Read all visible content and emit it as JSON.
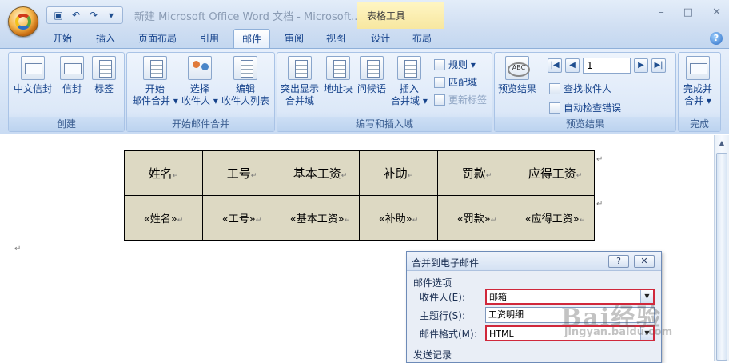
{
  "window": {
    "title": "新建 Microsoft Office Word 文档 - Microsoft...",
    "context_group": "表格工具",
    "minimize": "–",
    "restore": "□",
    "close": "✕"
  },
  "quick_access": {
    "save": "save-icon",
    "undo": "↶",
    "redo": "↷",
    "more": "▾"
  },
  "tabs": [
    {
      "label": "开始"
    },
    {
      "label": "插入"
    },
    {
      "label": "页面布局"
    },
    {
      "label": "引用"
    },
    {
      "label": "邮件"
    },
    {
      "label": "审阅"
    },
    {
      "label": "视图"
    },
    {
      "label": "设计"
    },
    {
      "label": "布局"
    }
  ],
  "active_tab": "邮件",
  "ribbon": {
    "create": {
      "label": "创建",
      "buttons": [
        "中文信封",
        "信封",
        "标签"
      ]
    },
    "start_merge": {
      "label": "开始邮件合并",
      "buttons": [
        {
          "line1": "开始",
          "line2": "邮件合并 ▾"
        },
        {
          "line1": "选择",
          "line2": "收件人 ▾"
        },
        {
          "line1": "编辑",
          "line2": "收件人列表"
        }
      ]
    },
    "write_insert": {
      "label": "编写和插入域",
      "buttons": [
        {
          "line1": "突出显示",
          "line2": "合并域"
        },
        {
          "line1": "地址块",
          "line2": ""
        },
        {
          "line1": "问候语",
          "line2": ""
        },
        {
          "line1": "插入",
          "line2": "合并域 ▾"
        }
      ],
      "small": [
        "规则 ▾",
        "匹配域",
        "更新标签"
      ]
    },
    "preview": {
      "label": "预览结果",
      "preview_button": "预览结果",
      "record": "1",
      "find": "查找收件人",
      "auto_check": "自动检查错误"
    },
    "finish": {
      "label": "完成",
      "line1": "完成并",
      "line2": "合并 ▾"
    }
  },
  "table": {
    "headers": [
      "姓名",
      "工号",
      "基本工资",
      "补助",
      "罚款",
      "应得工资"
    ],
    "fields": [
      "«姓名»",
      "«工号»",
      "«基本工资»",
      "«补助»",
      "«罚款»",
      "«应得工资»"
    ]
  },
  "dialog": {
    "title": "合并到电子邮件",
    "help": "?",
    "close": "✕",
    "section_options": "邮件选项",
    "recipient_label": "收件人(E):",
    "recipient_value": "邮箱",
    "subject_label": "主题行(S):",
    "subject_value": "工资明细",
    "format_label": "邮件格式(M):",
    "format_value": "HTML",
    "section_send": "发送记录"
  },
  "watermark": {
    "text": "Bai经验",
    "url": "jingyan.baidu.com"
  }
}
